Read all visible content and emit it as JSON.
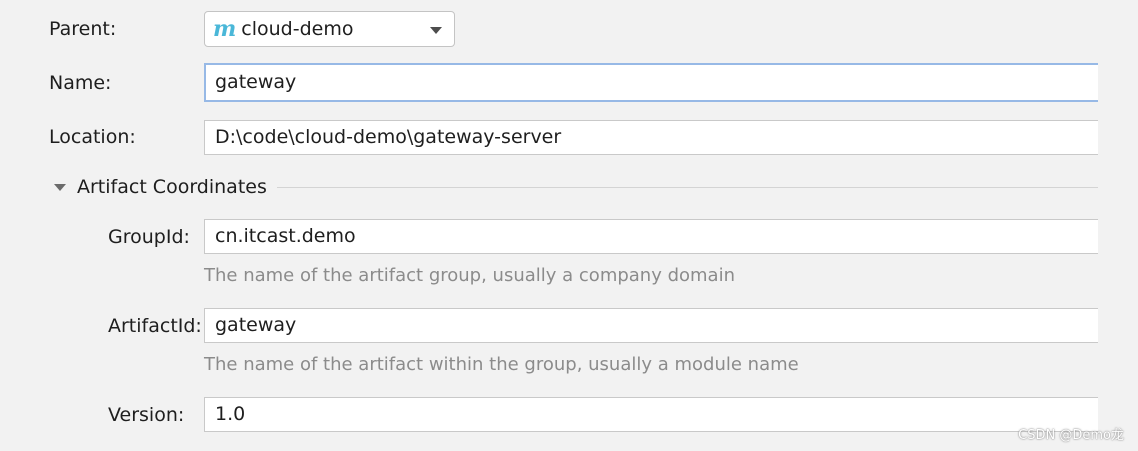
{
  "form": {
    "parent": {
      "label": "Parent:",
      "icon": "maven-m-icon",
      "icon_glyph": "m",
      "value": "cloud-demo"
    },
    "name": {
      "label": "Name:",
      "value": "gateway"
    },
    "location": {
      "label": "Location:",
      "value": "D:\\code\\cloud-demo\\gateway-server"
    }
  },
  "artifact_coordinates": {
    "title": "Artifact Coordinates",
    "group_id": {
      "label": "GroupId:",
      "value": "cn.itcast.demo",
      "hint": "The name of the artifact group, usually a company domain"
    },
    "artifact_id": {
      "label": "ArtifactId:",
      "value": "gateway",
      "hint": "The name of the artifact within the group, usually a module name"
    },
    "version": {
      "label": "Version:",
      "value": "1.0"
    }
  },
  "watermark": "CSDN @Demo龙",
  "colors": {
    "background": "#f2f2f2",
    "focus_border": "#97b9e6",
    "maven_icon": "#4ab7d8",
    "hint_text": "#8b8b8b"
  }
}
